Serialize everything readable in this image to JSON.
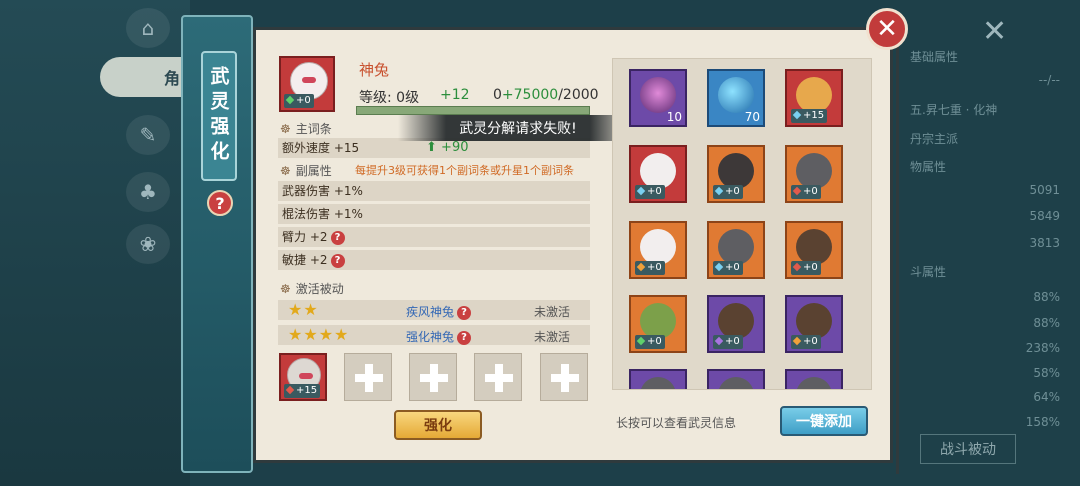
{
  "background": {
    "tab_label": "角",
    "close_glyph": "✕",
    "right_rows": [
      {
        "k": "基础属性",
        "v": ""
      },
      {
        "k": "",
        "v": "--/--"
      },
      {
        "k": "五.昇七重 · 化神",
        "v": ""
      },
      {
        "k": "丹宗主派",
        "v": ""
      },
      {
        "k": "物属性",
        "v": ""
      },
      {
        "k": "",
        "v": "5091"
      },
      {
        "k": "",
        "v": "5849"
      },
      {
        "k": "",
        "v": "3813"
      },
      {
        "k": "斗属性",
        "v": ""
      },
      {
        "k": "",
        "v": "88%"
      },
      {
        "k": "",
        "v": "88%"
      },
      {
        "k": "",
        "v": "238%"
      },
      {
        "k": "",
        "v": "58%"
      },
      {
        "k": "",
        "v": "64%"
      },
      {
        "k": "",
        "v": "158%"
      }
    ],
    "battle_passive": "战斗被动"
  },
  "side": {
    "title": "武灵强化",
    "help": "?"
  },
  "close": "✕",
  "pet": {
    "name": "神兔",
    "plus": "+0",
    "level_label": "等级: 0级",
    "level_add": "+12",
    "exp_base": "0",
    "exp_add": "+75000",
    "exp_max": "/2000"
  },
  "toast": "武灵分解请求失败!",
  "main_entry": {
    "title": "主词条",
    "stat": "额外速度 +15",
    "up": "+90"
  },
  "sub_attr": {
    "title": "副属性",
    "hint": "每提升3级可获得1个副词条或升星1个副词条",
    "rows": [
      {
        "label": "武器伤害 +1%"
      },
      {
        "label": "棍法伤害 +1%"
      },
      {
        "label": "臂力 +2"
      },
      {
        "label": "敏捷 +2"
      }
    ]
  },
  "passive": {
    "title": "激活被动",
    "items": [
      {
        "stars": "★★",
        "name": "疾风神兔",
        "status": "未激活"
      },
      {
        "stars": "★★★★",
        "name": "强化神兔",
        "status": "未激活"
      }
    ]
  },
  "material_slot": {
    "plus": "+15"
  },
  "buttons": {
    "enhance": "强化",
    "longpress": "长按可以查看武灵信息",
    "one_click_add": "一键添加"
  },
  "inventory": [
    {
      "frame": "purple",
      "face": "spider",
      "num": "10"
    },
    {
      "frame": "blue",
      "face": "orb",
      "num": "70"
    },
    {
      "frame": "red",
      "face": "dragon",
      "plus": "+15",
      "gem": "blue"
    },
    {
      "frame": "red",
      "face": "white",
      "plus": "+0",
      "gem": "blue"
    },
    {
      "frame": "orange",
      "face": "boar",
      "plus": "+0",
      "gem": "blue"
    },
    {
      "frame": "orange",
      "face": "wolf",
      "plus": "+0",
      "gem": "red"
    },
    {
      "frame": "orange",
      "face": "white",
      "plus": "+0",
      "gem": "orange"
    },
    {
      "frame": "orange",
      "face": "wolf",
      "plus": "+0",
      "gem": "blue"
    },
    {
      "frame": "orange",
      "face": "bear",
      "plus": "+0",
      "gem": "red"
    },
    {
      "frame": "orange",
      "face": "turtle",
      "plus": "+0",
      "gem": "green"
    },
    {
      "frame": "purple",
      "face": "bear",
      "plus": "+0",
      "gem": "purple"
    },
    {
      "frame": "purple",
      "face": "bear",
      "plus": "+0",
      "gem": "orange"
    },
    {
      "frame": "purple",
      "face": "wolf",
      "plus": "",
      "gem": ""
    },
    {
      "frame": "purple",
      "face": "wolf",
      "plus": "",
      "gem": ""
    },
    {
      "frame": "purple",
      "face": "wolf",
      "plus": "",
      "gem": ""
    }
  ]
}
